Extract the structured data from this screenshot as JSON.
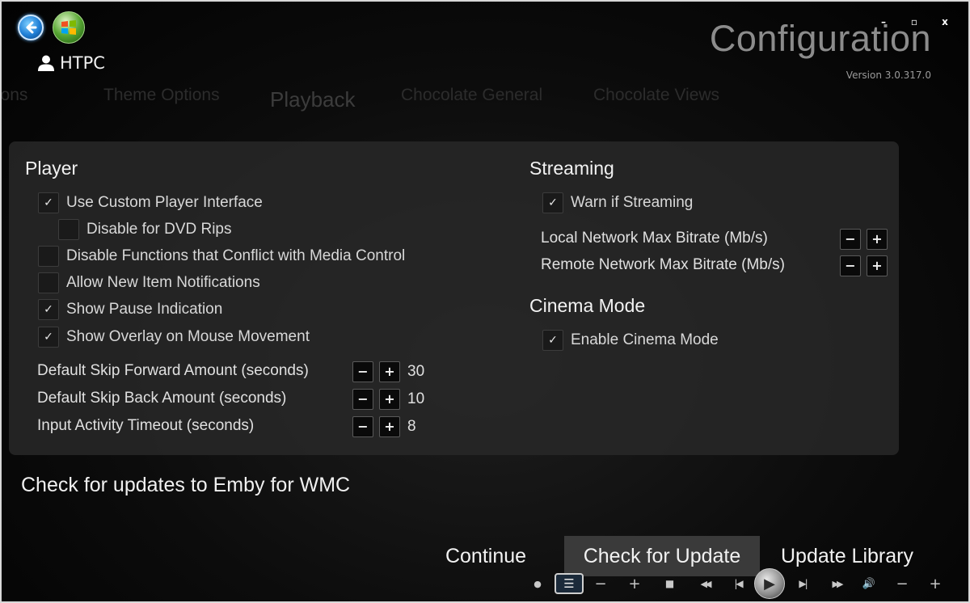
{
  "header": {
    "user_name": "HTPC",
    "title": "Configuration",
    "version": "Version 3.0.317.0",
    "window_controls": [
      "–",
      "▫",
      "x"
    ]
  },
  "tabs": [
    {
      "label": "Options",
      "active": false
    },
    {
      "label": "Theme Options",
      "active": false
    },
    {
      "label": "Playback",
      "active": true
    },
    {
      "label": "Chocolate General",
      "active": false
    },
    {
      "label": "Chocolate Views",
      "active": false
    }
  ],
  "player": {
    "title": "Player",
    "options": [
      {
        "label": "Use Custom Player Interface",
        "checked": true
      },
      {
        "label": "Disable for DVD Rips",
        "checked": false
      },
      {
        "label": "Disable Functions that Conflict with Media Control",
        "checked": false
      },
      {
        "label": "Allow New Item Notifications",
        "checked": false
      },
      {
        "label": "Show Pause Indication",
        "checked": true
      },
      {
        "label": "Show Overlay on Mouse Movement",
        "checked": true
      }
    ],
    "settings": [
      {
        "label": "Default Skip Forward Amount (seconds)",
        "value": "30"
      },
      {
        "label": "Default Skip Back Amount (seconds)",
        "value": "10"
      },
      {
        "label": "Input Activity Timeout (seconds)",
        "value": "8"
      }
    ]
  },
  "streaming": {
    "title": "Streaming",
    "warn": {
      "label": "Warn if Streaming",
      "checked": true
    },
    "settings": [
      {
        "label": "Local Network Max Bitrate (Mb/s)",
        "value": ""
      },
      {
        "label": "Remote Network Max Bitrate (Mb/s)",
        "value": ""
      }
    ]
  },
  "cinema": {
    "title": "Cinema Mode",
    "enable": {
      "label": "Enable Cinema Mode",
      "checked": true
    }
  },
  "stepper": {
    "minus": "−",
    "plus": "+"
  },
  "check_mark": "✓",
  "update_text": "Check for updates to Emby for WMC",
  "actions": {
    "continue": "Continue",
    "check_update": "Check for Update",
    "update_library": "Update Library"
  },
  "transport_icons": [
    "record-dot",
    "guide-list",
    "channel-down",
    "channel-up",
    "stop",
    "rewind",
    "skip-back",
    "play",
    "skip-forward",
    "fast-forward",
    "volume",
    "volume-down",
    "volume-up"
  ],
  "transport": {
    "dot": "●",
    "list": "☰",
    "minus": "−",
    "plus": "+",
    "stop": "■",
    "rewind": "◀◀",
    "skip_back": "|◀",
    "play": "▶",
    "skip_forward": "▶|",
    "fast_forward": "▶▶",
    "volume": "🔊",
    "vol_down": "−",
    "vol_up": "+"
  }
}
